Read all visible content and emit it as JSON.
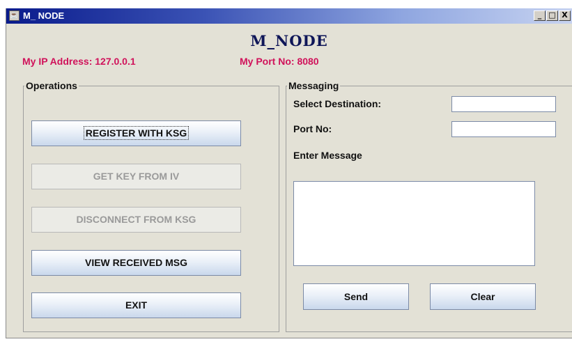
{
  "window": {
    "title": "M_ NODE",
    "app_icon": "java-cup-icon",
    "minimize": "_",
    "maximize": "□",
    "close": "X"
  },
  "heading": "M_NODE",
  "info": {
    "ip": "My IP Address: 127.0.0.1",
    "port": "My Port No: 8080"
  },
  "operations": {
    "title": "Operations",
    "buttons": [
      {
        "label": "REGISTER WITH KSG",
        "enabled": true
      },
      {
        "label": "GET KEY FROM IV",
        "enabled": false
      },
      {
        "label": "DISCONNECT FROM KSG",
        "enabled": false
      },
      {
        "label": "VIEW RECEIVED MSG",
        "enabled": true
      },
      {
        "label": "EXIT",
        "enabled": true
      }
    ]
  },
  "messaging": {
    "title": "Messaging",
    "destination_label": "Select Destination:",
    "destination_value": "",
    "port_label": "Port No:",
    "port_value": "",
    "message_label": "Enter Message",
    "message_value": "",
    "send_label": "Send",
    "clear_label": "Clear"
  },
  "colors": {
    "title_gradient_start": "#0a1b8c",
    "heading": "#0f1658",
    "info_text": "#d0125a",
    "panel_bg": "#e3e1d6"
  }
}
